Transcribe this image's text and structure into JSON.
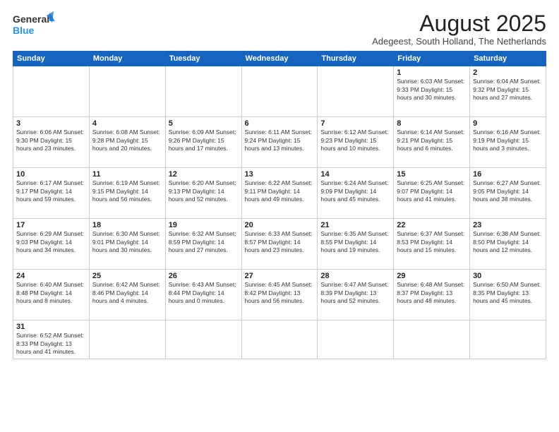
{
  "header": {
    "logo_general": "General",
    "logo_blue": "Blue",
    "title": "August 2025",
    "subtitle": "Adegeest, South Holland, The Netherlands"
  },
  "calendar": {
    "days_of_week": [
      "Sunday",
      "Monday",
      "Tuesday",
      "Wednesday",
      "Thursday",
      "Friday",
      "Saturday"
    ],
    "weeks": [
      [
        {
          "day": "",
          "info": ""
        },
        {
          "day": "",
          "info": ""
        },
        {
          "day": "",
          "info": ""
        },
        {
          "day": "",
          "info": ""
        },
        {
          "day": "",
          "info": ""
        },
        {
          "day": "1",
          "info": "Sunrise: 6:03 AM\nSunset: 9:33 PM\nDaylight: 15 hours\nand 30 minutes."
        },
        {
          "day": "2",
          "info": "Sunrise: 6:04 AM\nSunset: 9:32 PM\nDaylight: 15 hours\nand 27 minutes."
        }
      ],
      [
        {
          "day": "3",
          "info": "Sunrise: 6:06 AM\nSunset: 9:30 PM\nDaylight: 15 hours\nand 23 minutes."
        },
        {
          "day": "4",
          "info": "Sunrise: 6:08 AM\nSunset: 9:28 PM\nDaylight: 15 hours\nand 20 minutes."
        },
        {
          "day": "5",
          "info": "Sunrise: 6:09 AM\nSunset: 9:26 PM\nDaylight: 15 hours\nand 17 minutes."
        },
        {
          "day": "6",
          "info": "Sunrise: 6:11 AM\nSunset: 9:24 PM\nDaylight: 15 hours\nand 13 minutes."
        },
        {
          "day": "7",
          "info": "Sunrise: 6:12 AM\nSunset: 9:23 PM\nDaylight: 15 hours\nand 10 minutes."
        },
        {
          "day": "8",
          "info": "Sunrise: 6:14 AM\nSunset: 9:21 PM\nDaylight: 15 hours\nand 6 minutes."
        },
        {
          "day": "9",
          "info": "Sunrise: 6:16 AM\nSunset: 9:19 PM\nDaylight: 15 hours\nand 3 minutes."
        }
      ],
      [
        {
          "day": "10",
          "info": "Sunrise: 6:17 AM\nSunset: 9:17 PM\nDaylight: 14 hours\nand 59 minutes."
        },
        {
          "day": "11",
          "info": "Sunrise: 6:19 AM\nSunset: 9:15 PM\nDaylight: 14 hours\nand 56 minutes."
        },
        {
          "day": "12",
          "info": "Sunrise: 6:20 AM\nSunset: 9:13 PM\nDaylight: 14 hours\nand 52 minutes."
        },
        {
          "day": "13",
          "info": "Sunrise: 6:22 AM\nSunset: 9:11 PM\nDaylight: 14 hours\nand 49 minutes."
        },
        {
          "day": "14",
          "info": "Sunrise: 6:24 AM\nSunset: 9:09 PM\nDaylight: 14 hours\nand 45 minutes."
        },
        {
          "day": "15",
          "info": "Sunrise: 6:25 AM\nSunset: 9:07 PM\nDaylight: 14 hours\nand 41 minutes."
        },
        {
          "day": "16",
          "info": "Sunrise: 6:27 AM\nSunset: 9:05 PM\nDaylight: 14 hours\nand 38 minutes."
        }
      ],
      [
        {
          "day": "17",
          "info": "Sunrise: 6:29 AM\nSunset: 9:03 PM\nDaylight: 14 hours\nand 34 minutes."
        },
        {
          "day": "18",
          "info": "Sunrise: 6:30 AM\nSunset: 9:01 PM\nDaylight: 14 hours\nand 30 minutes."
        },
        {
          "day": "19",
          "info": "Sunrise: 6:32 AM\nSunset: 8:59 PM\nDaylight: 14 hours\nand 27 minutes."
        },
        {
          "day": "20",
          "info": "Sunrise: 6:33 AM\nSunset: 8:57 PM\nDaylight: 14 hours\nand 23 minutes."
        },
        {
          "day": "21",
          "info": "Sunrise: 6:35 AM\nSunset: 8:55 PM\nDaylight: 14 hours\nand 19 minutes."
        },
        {
          "day": "22",
          "info": "Sunrise: 6:37 AM\nSunset: 8:53 PM\nDaylight: 14 hours\nand 15 minutes."
        },
        {
          "day": "23",
          "info": "Sunrise: 6:38 AM\nSunset: 8:50 PM\nDaylight: 14 hours\nand 12 minutes."
        }
      ],
      [
        {
          "day": "24",
          "info": "Sunrise: 6:40 AM\nSunset: 8:48 PM\nDaylight: 14 hours\nand 8 minutes."
        },
        {
          "day": "25",
          "info": "Sunrise: 6:42 AM\nSunset: 8:46 PM\nDaylight: 14 hours\nand 4 minutes."
        },
        {
          "day": "26",
          "info": "Sunrise: 6:43 AM\nSunset: 8:44 PM\nDaylight: 14 hours\nand 0 minutes."
        },
        {
          "day": "27",
          "info": "Sunrise: 6:45 AM\nSunset: 8:42 PM\nDaylight: 13 hours\nand 56 minutes."
        },
        {
          "day": "28",
          "info": "Sunrise: 6:47 AM\nSunset: 8:39 PM\nDaylight: 13 hours\nand 52 minutes."
        },
        {
          "day": "29",
          "info": "Sunrise: 6:48 AM\nSunset: 8:37 PM\nDaylight: 13 hours\nand 48 minutes."
        },
        {
          "day": "30",
          "info": "Sunrise: 6:50 AM\nSunset: 8:35 PM\nDaylight: 13 hours\nand 45 minutes."
        }
      ],
      [
        {
          "day": "31",
          "info": "Sunrise: 6:52 AM\nSunset: 8:33 PM\nDaylight: 13 hours\nand 41 minutes."
        },
        {
          "day": "",
          "info": ""
        },
        {
          "day": "",
          "info": ""
        },
        {
          "day": "",
          "info": ""
        },
        {
          "day": "",
          "info": ""
        },
        {
          "day": "",
          "info": ""
        },
        {
          "day": "",
          "info": ""
        }
      ]
    ]
  }
}
